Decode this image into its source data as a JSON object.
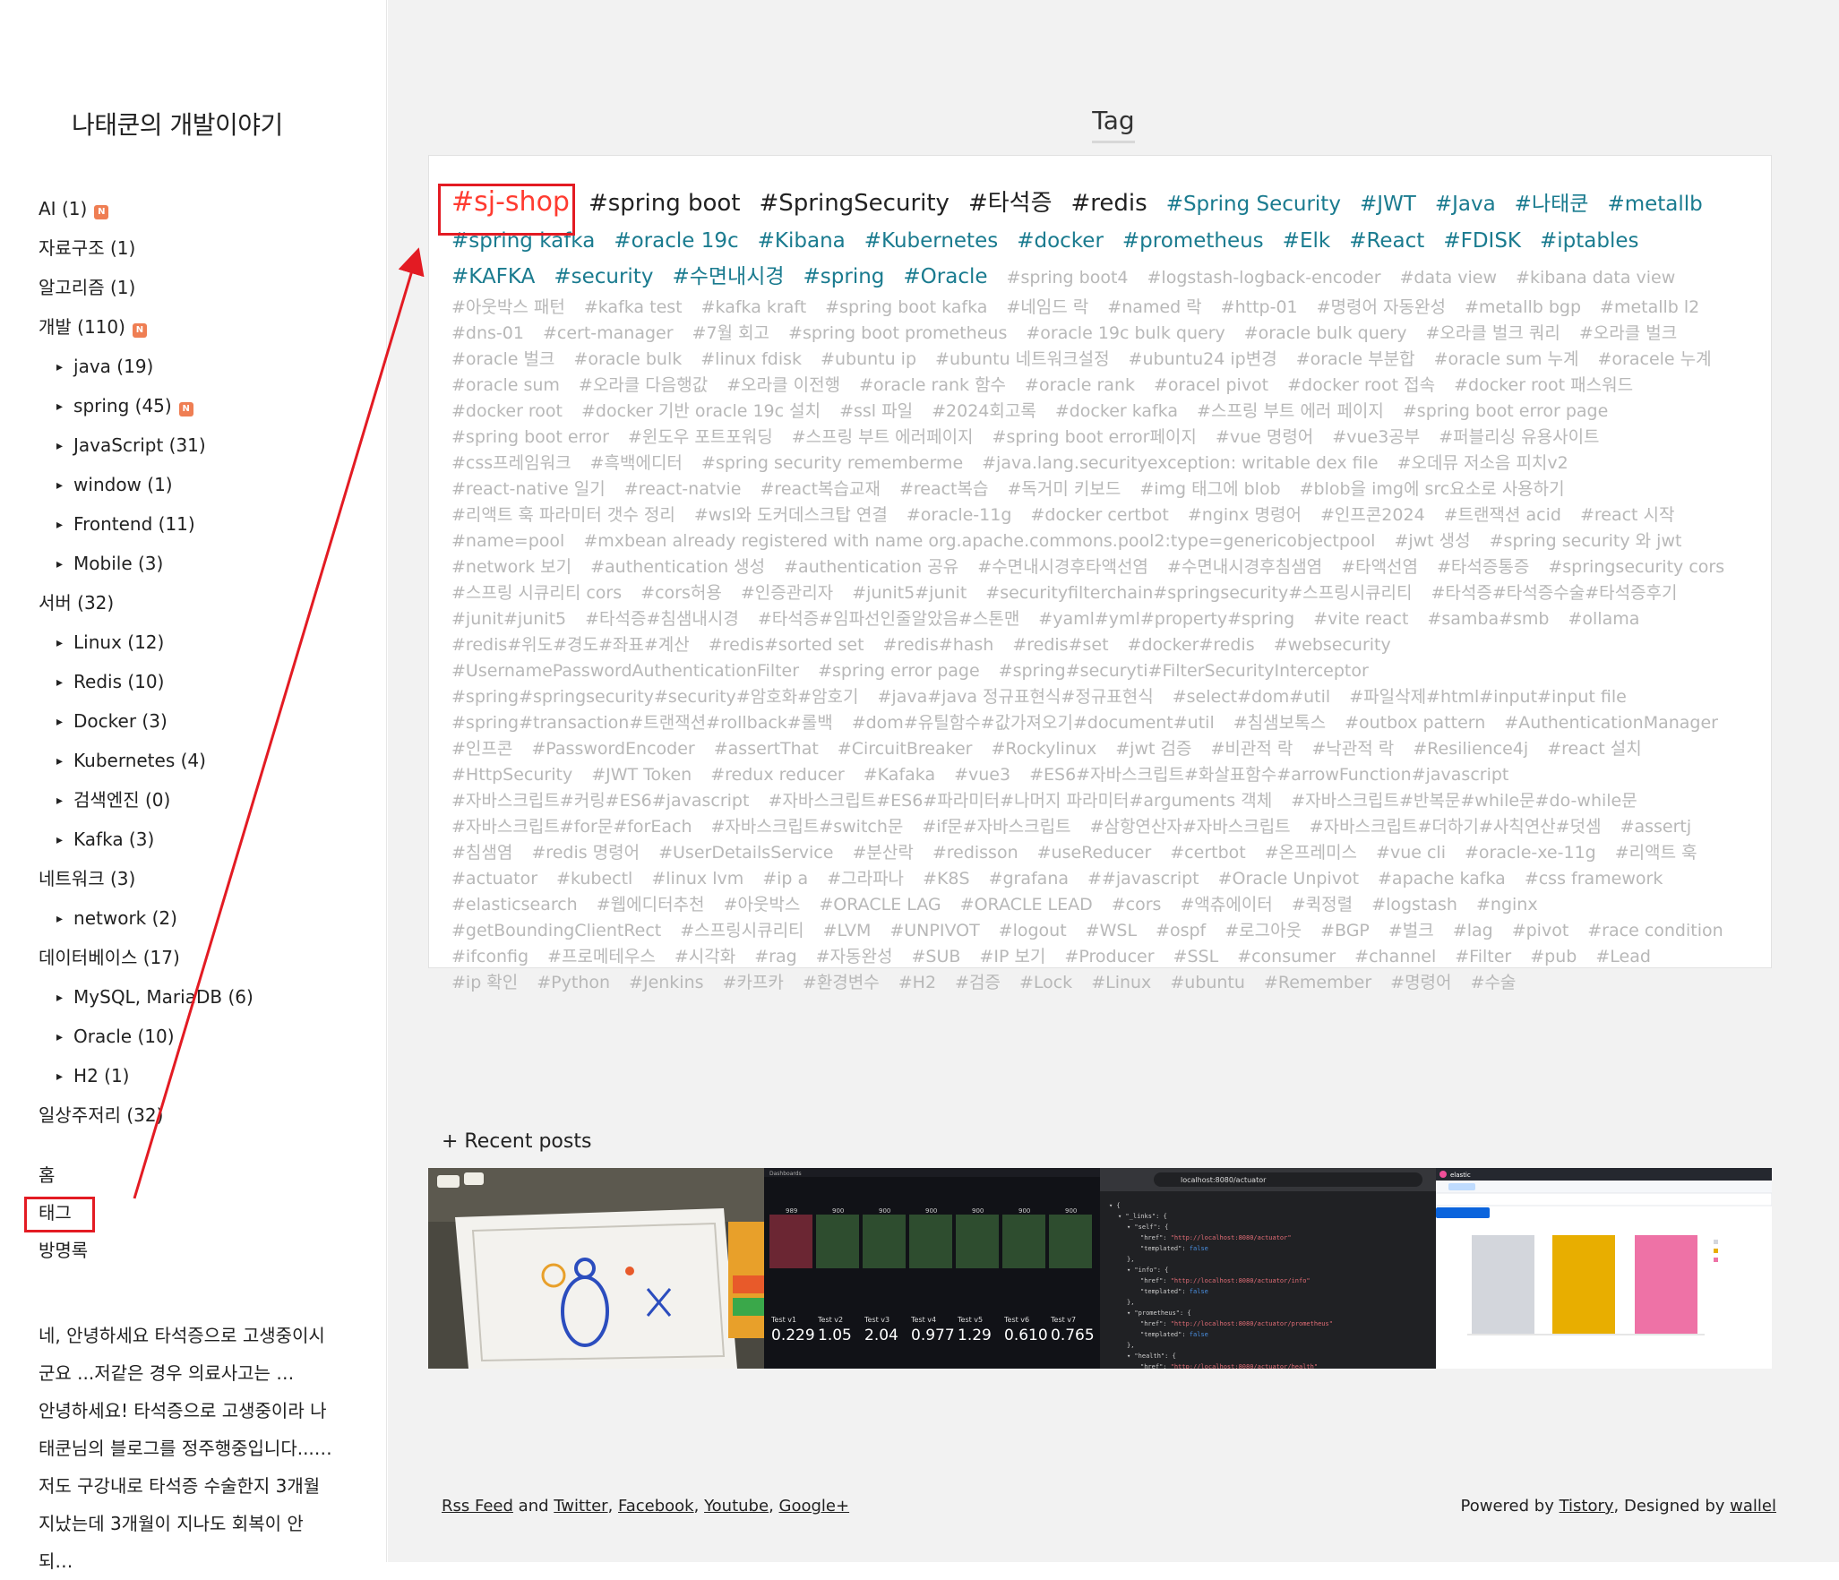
{
  "blog": {
    "title": "나태쿤의 개발이야기"
  },
  "categories": [
    {
      "label": "AI (1)",
      "level": 0,
      "new": true
    },
    {
      "label": "자료구조 (1)",
      "level": 0,
      "new": false
    },
    {
      "label": "알고리즘 (1)",
      "level": 0,
      "new": false
    },
    {
      "label": "개발 (110)",
      "level": 0,
      "new": true
    },
    {
      "label": "java (19)",
      "level": 1,
      "new": false
    },
    {
      "label": "spring (45)",
      "level": 1,
      "new": true
    },
    {
      "label": "JavaScript (31)",
      "level": 1,
      "new": false
    },
    {
      "label": "window (1)",
      "level": 1,
      "new": false
    },
    {
      "label": "Frontend (11)",
      "level": 1,
      "new": false
    },
    {
      "label": "Mobile (3)",
      "level": 1,
      "new": false
    },
    {
      "label": "서버 (32)",
      "level": 0,
      "new": false
    },
    {
      "label": "Linux (12)",
      "level": 1,
      "new": false
    },
    {
      "label": "Redis (10)",
      "level": 1,
      "new": false
    },
    {
      "label": "Docker (3)",
      "level": 1,
      "new": false
    },
    {
      "label": "Kubernetes (4)",
      "level": 1,
      "new": false
    },
    {
      "label": "검색엔진 (0)",
      "level": 1,
      "new": false
    },
    {
      "label": "Kafka (3)",
      "level": 1,
      "new": false
    },
    {
      "label": "네트워크 (3)",
      "level": 0,
      "new": false
    },
    {
      "label": "network (2)",
      "level": 1,
      "new": false
    },
    {
      "label": "데이터베이스 (17)",
      "level": 0,
      "new": false
    },
    {
      "label": "MySQL, MariaDB (6)",
      "level": 1,
      "new": false
    },
    {
      "label": "Oracle (10)",
      "level": 1,
      "new": false
    },
    {
      "label": "H2 (1)",
      "level": 1,
      "new": false
    },
    {
      "label": "일상주저리 (32)",
      "level": 0,
      "new": false
    }
  ],
  "badge_text": "N",
  "menu": {
    "home": "홈",
    "tag": "태그",
    "guestbook": "방명록"
  },
  "recent_comments": [
    "네, 안녕하세요 타석증으로 고생중이시",
    "군요 ...저같은 경우 의료사고는 …",
    "안녕하세요! 타석증으로 고생중이라 나",
    "태쿤님의 블로그를 정주행중입니다...…",
    "저도 구강내로 타석증 수술한지 3개월",
    "지났는데 3개월이 지나도 회복이 안",
    "되…"
  ],
  "tag_page": {
    "heading": "Tag"
  },
  "tags_featured": [
    {
      "text": "#sj-shop",
      "tier": 1
    },
    {
      "text": "#spring boot",
      "tier": 2
    },
    {
      "text": "#SpringSecurity",
      "tier": 2
    },
    {
      "text": "#타석증",
      "tier": 2
    },
    {
      "text": "#redis",
      "tier": 2
    },
    {
      "text": "#Spring Security",
      "tier": 3
    },
    {
      "text": "#JWT",
      "tier": 3
    },
    {
      "text": "#Java",
      "tier": 3
    },
    {
      "text": "#나태쿤",
      "tier": 3
    },
    {
      "text": "#metallb",
      "tier": 3
    },
    {
      "text": "#spring kafka",
      "tier": 3
    },
    {
      "text": "#oracle 19c",
      "tier": 3
    },
    {
      "text": "#Kibana",
      "tier": 3
    },
    {
      "text": "#Kubernetes",
      "tier": 3
    },
    {
      "text": "#docker",
      "tier": 3
    },
    {
      "text": "#prometheus",
      "tier": 3
    },
    {
      "text": "#Elk",
      "tier": 3
    },
    {
      "text": "#React",
      "tier": 3
    },
    {
      "text": "#FDISK",
      "tier": 3
    },
    {
      "text": "#iptables",
      "tier": 3
    },
    {
      "text": "#KAFKA",
      "tier": 3
    },
    {
      "text": "#security",
      "tier": 3
    },
    {
      "text": "#수면내시경",
      "tier": 3
    },
    {
      "text": "#spring",
      "tier": 3
    },
    {
      "text": "#Oracle",
      "tier": 3
    }
  ],
  "tags_minor": [
    "#spring boot4",
    "#logstash-logback-encoder",
    "#data view",
    "#kibana data view",
    "#아웃박스 패턴",
    "#kafka test",
    "#kafka kraft",
    "#spring boot kafka",
    "#네임드 락",
    "#named 락",
    "#http-01",
    "#명령어 자동완성",
    "#metallb bgp",
    "#metallb l2",
    "#dns-01",
    "#cert-manager",
    "#7월 회고",
    "#spring boot prometheus",
    "#oracle 19c bulk query",
    "#oracle bulk query",
    "#오라클 벌크 쿼리",
    "#오라클 벌크",
    "#oracle 벌크",
    "#oracle bulk",
    "#linux fdisk",
    "#ubuntu ip",
    "#ubuntu 네트워크설정",
    "#ubuntu24 ip변경",
    "#oracle 부분합",
    "#oracle sum 누계",
    "#oracele 누계",
    "#oracle sum",
    "#오라클 다음행값",
    "#오라클 이전행",
    "#oracle rank 함수",
    "#oracle rank",
    "#oracel pivot",
    "#docker root 접속",
    "#docker root 패스워드",
    "#docker root",
    "#docker 기반 oracle 19c 설치",
    "#ssl 파일",
    "#2024회고록",
    "#docker kafka",
    "#스프링 부트 에러 페이지",
    "#spring boot error page",
    "#spring boot error",
    "#윈도우 포트포워딩",
    "#스프링 부트 에러페이지",
    "#spring boot error페이지",
    "#vue 명령어",
    "#vue3공부",
    "#퍼블리싱 유용사이트",
    "#css프레임워크",
    "#흑백에디터",
    "#spring security rememberme",
    "#java.lang.securityexception: writable dex file",
    "#오데뮤 저소음 피치v2",
    "#react-native 일기",
    "#react-natvie",
    "#react복습교재",
    "#react복습",
    "#독거미 키보드",
    "#img 태그에 blob",
    "#blob을 img에 src요소로 사용하기",
    "#리액트 훅 파라미터 갯수 정리",
    "#wsl와 도커데스크탑 연결",
    "#oracle-11g",
    "#docker certbot",
    "#nginx 명령어",
    "#인프콘2024",
    "#트랜잭션 acid",
    "#react 시작",
    "#name=pool",
    "#mxbean already registered with name org.apache.commons.pool2:type=genericobjectpool",
    "#jwt 생성",
    "#spring security 와 jwt",
    "#network 보기",
    "#authentication 생성",
    "#authentication 공유",
    "#수면내시경후타액선염",
    "#수면내시경후침샘염",
    "#타액선염",
    "#타석증통증",
    "#springsecurity cors",
    "#스프링 시큐리티 cors",
    "#cors허용",
    "#인증관리자",
    "#junit5#junit",
    "#securityfilterchain#springsecurity#스프링시큐리티",
    "#타석증#타석증수술#타석증후기",
    "#junit#junit5",
    "#타석증#침샘내시경",
    "#타석증#임파선인줄알았음#스톤맨",
    "#yaml#yml#property#spring",
    "#vite react",
    "#samba#smb",
    "#ollama",
    "#redis#위도#경도#좌표#계산",
    "#redis#sorted set",
    "#redis#hash",
    "#redis#set",
    "#docker#redis",
    "#websecurity",
    "#UsernamePasswordAuthenticationFilter",
    "#spring error page",
    "#spring#securyti#FilterSecurityInterceptor",
    "#spring#springsecurity#security#암호화#암호기",
    "#java#java 정규표현식#정규표현식",
    "#select#dom#util",
    "#파일삭제#html#input#input file",
    "#spring#transaction#트랜잭션#rollback#롤백",
    "#dom#유틸함수#값가져오기#document#util",
    "#침샘보톡스",
    "#outbox pattern",
    "#AuthenticationManager",
    "#인프콘",
    "#PasswordEncoder",
    "#assertThat",
    "#CircuitBreaker",
    "#Rockylinux",
    "#jwt 검증",
    "#비관적 락",
    "#낙관적 락",
    "#Resilience4j",
    "#react 설치",
    "#HttpSecurity",
    "#JWT Token",
    "#redux reducer",
    "#Kafaka",
    "#vue3",
    "#ES6#자바스크립트#화살표함수#arrowFunction#javascript",
    "#자바스크립트#커링#ES6#javascript",
    "#자바스크립트#ES6#파라미터#나머지 파라미터#arguments 객체",
    "#자바스크립트#반복문#while문#do-while문",
    "#자바스크립트#for문#forEach",
    "#자바스크립트#switch문",
    "#if문#자바스크립트",
    "#삼항연산자#자바스크립트",
    "#자바스크립트#더하기#사칙연산#덧셈",
    "#assertj",
    "#침샘염",
    "#redis 명령어",
    "#UserDetailsService",
    "#분산락",
    "#redisson",
    "#useReducer",
    "#certbot",
    "#온프레미스",
    "#vue cli",
    "#oracle-xe-11g",
    "#리액트 훅",
    "#actuator",
    "#kubectl",
    "#linux lvm",
    "#ip a",
    "#그라파나",
    "#K8S",
    "#grafana",
    "##javascript",
    "#Oracle Unpivot",
    "#apache kafka",
    "#css framework",
    "#elasticsearch",
    "#웹에디터추천",
    "#아웃박스",
    "#ORACLE LAG",
    "#ORACLE LEAD",
    "#cors",
    "#액츄에이터",
    "#퀵정렬",
    "#logstash",
    "#nginx",
    "#getBoundingClientRect",
    "#스프링시큐리티",
    "#LVM",
    "#UNPIVOT",
    "#logout",
    "#WSL",
    "#ospf",
    "#로그아웃",
    "#BGP",
    "#벌크",
    "#lag",
    "#pivot",
    "#race condition",
    "#ifconfig",
    "#프로메테우스",
    "#시각화",
    "#rag",
    "#자동완성",
    "#SUB",
    "#IP 보기",
    "#Producer",
    "#SSL",
    "#consumer",
    "#channel",
    "#Filter",
    "#pub",
    "#Lead",
    "#ip 확인",
    "#Python",
    "#Jenkins",
    "#카프카",
    "#환경변수",
    "#H2",
    "#검증",
    "#Lock",
    "#Linux",
    "#ubuntu",
    "#Remember",
    "#명령어",
    "#수술"
  ],
  "recent": {
    "title": "+ Recent posts",
    "thumb2": {
      "header": "Dashboards",
      "values": [
        "0.229",
        "1.05",
        "2.04",
        "0.977",
        "1.29",
        "0.610",
        "0.765"
      ],
      "labels": [
        "Test v1",
        "Test v2",
        "Test v3",
        "Test v4",
        "Test v5",
        "Test v6",
        "Test v7"
      ],
      "bars": [
        "989",
        "900",
        "900",
        "900",
        "900",
        "900",
        "900"
      ]
    },
    "thumb3": {
      "url": "localhost:8080/actuator"
    },
    "thumb4": {
      "brand": "elastic"
    }
  },
  "footer": {
    "left_text_1": "Rss Feed",
    "left_and": " and ",
    "left_twitter": "Twitter",
    "left_comma1": ", ",
    "left_facebook": "Facebook",
    "left_comma2": ", ",
    "left_youtube": "Youtube",
    "left_comma3": ", ",
    "left_google": "Google+",
    "right_powered": "Powered by ",
    "right_tistory": "Tistory",
    "right_designed": ", Designed by ",
    "right_wallel": "wallel"
  },
  "colors": {
    "annotation": "#e31b23",
    "featured_tag": "#ff3b30",
    "tier3_tag": "#1a7b8f",
    "minor_tag": "#b8b8b8",
    "badge": "#ef7e53"
  }
}
